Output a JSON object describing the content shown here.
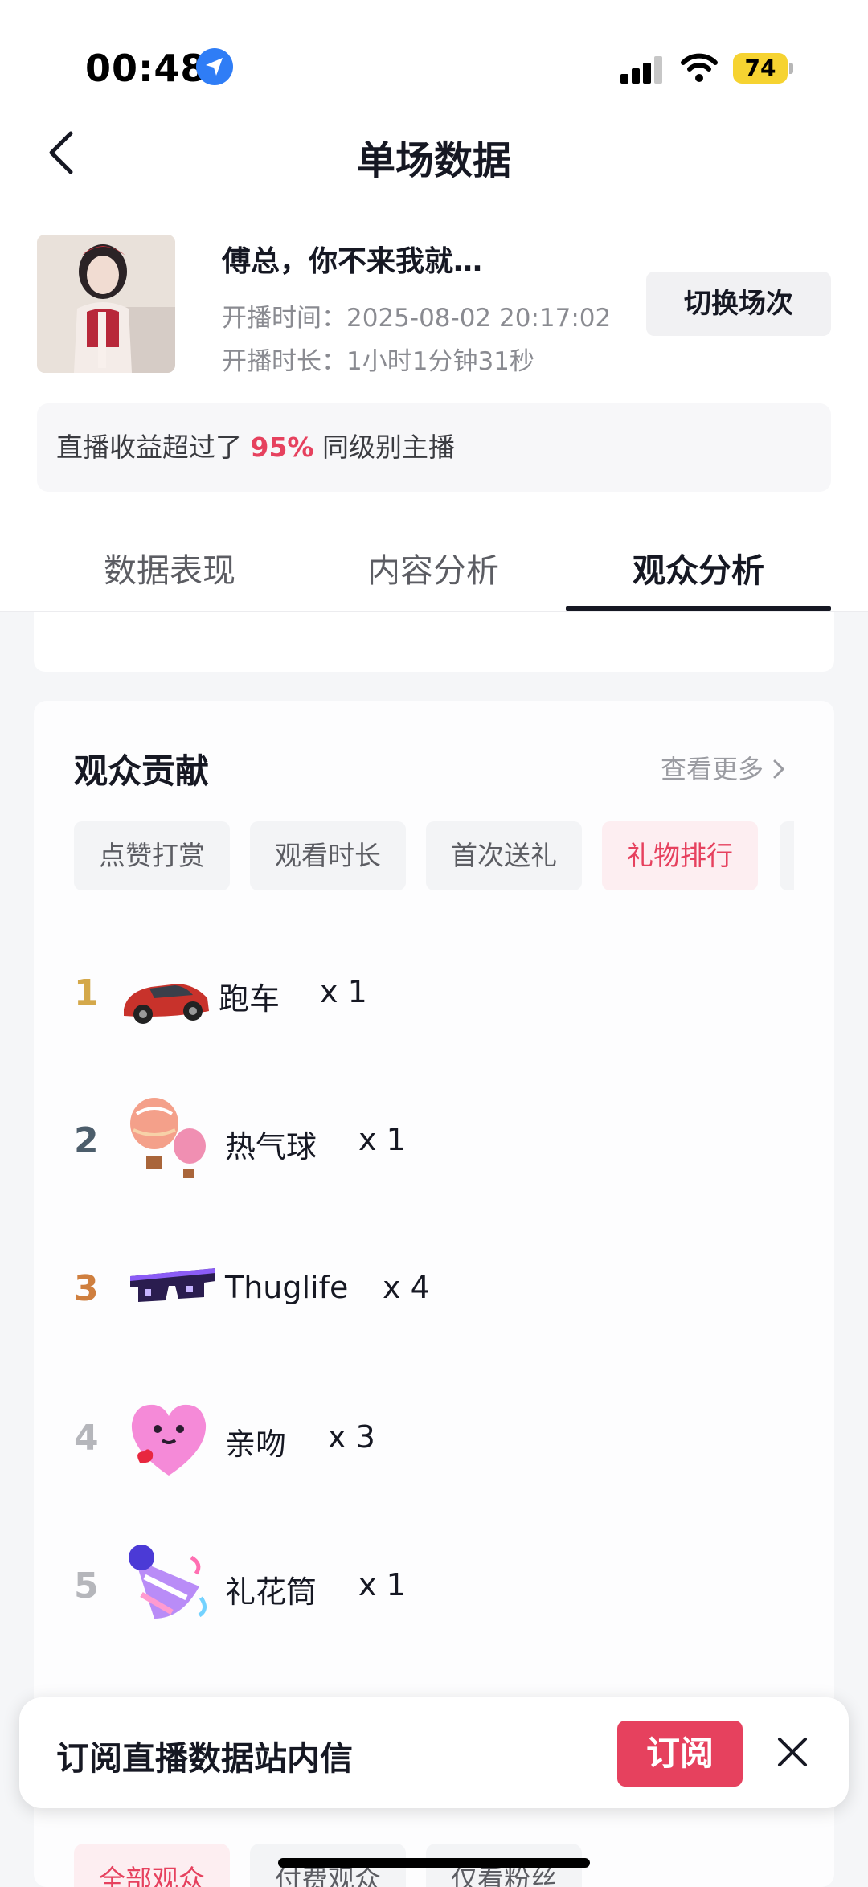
{
  "status_bar": {
    "time": "00:48",
    "battery": "74"
  },
  "nav": {
    "title": "单场数据"
  },
  "stream": {
    "title": "傅总，你不来我就…",
    "start_time": "开播时间：2025-08-02 20:17:02",
    "duration": "开播时长：1小时1分钟31秒",
    "switch_label": "切换场次"
  },
  "rank_banner": {
    "prefix": "直播收益超过了",
    "percent": "95%",
    "suffix": "同级别主播"
  },
  "tabs": [
    {
      "label": "数据表现"
    },
    {
      "label": "内容分析"
    },
    {
      "label": "观众分析"
    }
  ],
  "active_tab": 2,
  "contribution": {
    "title": "观众贡献",
    "more": "查看更多",
    "chips": [
      {
        "label": "点赞打赏"
      },
      {
        "label": "观看时长"
      },
      {
        "label": "首次送礼"
      },
      {
        "label": "礼物排行"
      }
    ],
    "gifts": [
      {
        "rank": "1",
        "name": "跑车",
        "count": "x 1"
      },
      {
        "rank": "2",
        "name": "热气球",
        "count": "x 1"
      },
      {
        "rank": "3",
        "name": "Thuglife",
        "count": "x 4"
      },
      {
        "rank": "4",
        "name": "亲吻",
        "count": "x 3"
      },
      {
        "rank": "5",
        "name": "礼花筒",
        "count": "x 1"
      }
    ]
  },
  "filters": [
    {
      "label": "全部观众"
    },
    {
      "label": "付费观众"
    },
    {
      "label": "仅看粉丝"
    }
  ],
  "popup": {
    "text": "订阅直播数据站内信",
    "button": "订阅"
  },
  "colors": {
    "accent": "#e6415e",
    "gold": "#d4a84a",
    "silver": "#4c5d6b",
    "bronze": "#cf7f3f",
    "muted": "#b5b6bb"
  }
}
